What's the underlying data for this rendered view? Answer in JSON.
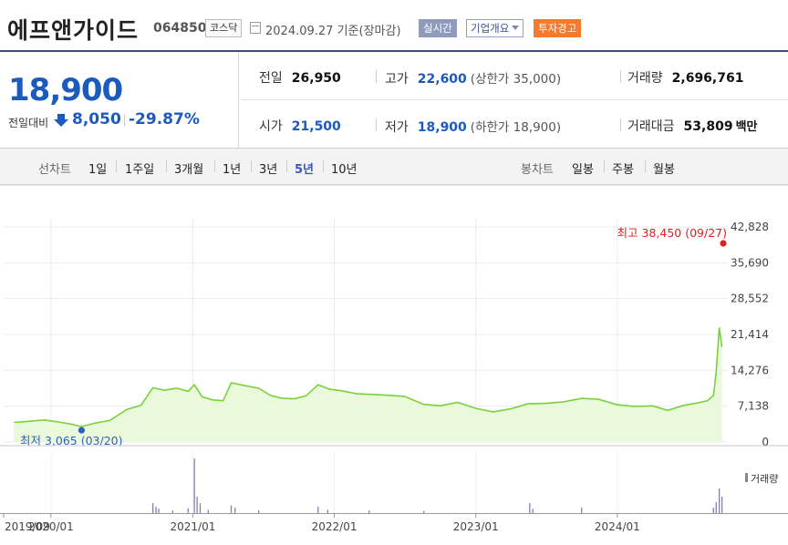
{
  "header": {
    "name": "에프앤가이드",
    "code": "064850",
    "market": "코스닥",
    "date": "2024.09.27",
    "date_note": "기준(장마감)",
    "btn_realtime": "실시간",
    "btn_company": "기업개요",
    "btn_warning": "투자경고"
  },
  "quote": {
    "price": "18,900",
    "change_label": "전일대비",
    "change_value": "8,050",
    "change_pct": "-29.87%",
    "down_color": "#1a5bbd",
    "prev_close_label": "전일",
    "prev_close": "26,950",
    "open_label": "시가",
    "open": "21,500",
    "high_label": "고가",
    "high": "22,600",
    "upper_limit": "(상한가 35,000)",
    "low_label": "저가",
    "low": "18,900",
    "lower_limit": "(하한가 18,900)",
    "volume_label": "거래량",
    "volume": "2,696,761",
    "amount_label": "거래대금",
    "amount": "53,809",
    "amount_unit": "백만"
  },
  "period_bar": {
    "line_title": "선차트",
    "periods": [
      "1일",
      "1주일",
      "3개월",
      "1년",
      "3년",
      "5년",
      "10년"
    ],
    "selected": "5년",
    "candle_title": "봉차트",
    "candles": [
      "일봉",
      "주봉",
      "월봉"
    ]
  },
  "chart_data": {
    "type": "area",
    "line_color": "#7ad23a",
    "fill_color": "#eaf8dc",
    "y_ticks": [
      "0",
      "7,138",
      "14,276",
      "21,414",
      "28,552",
      "35,690",
      "42,828"
    ],
    "ylim": [
      0,
      42828
    ],
    "x_ticks": [
      "2019/09",
      "2020/01",
      "2021/01",
      "2022/01",
      "2023/01",
      "2024/01"
    ],
    "max_label": "최고",
    "max_value": "38,450",
    "max_date": "(09/27)",
    "max_color": "#e0201e",
    "min_label": "최저",
    "min_value": "3,065",
    "min_date": "(03/20)",
    "min_color": "#2f63b8",
    "volume_legend": "거래량",
    "series": [
      {
        "x": "2019-09-27",
        "y": 3900
      },
      {
        "x": "2019-11-01",
        "y": 4100
      },
      {
        "x": "2019-12-15",
        "y": 4400
      },
      {
        "x": "2020-01-20",
        "y": 4000
      },
      {
        "x": "2020-02-20",
        "y": 3600
      },
      {
        "x": "2020-03-20",
        "y": 3065
      },
      {
        "x": "2020-04-20",
        "y": 3700
      },
      {
        "x": "2020-06-01",
        "y": 4300
      },
      {
        "x": "2020-07-15",
        "y": 6500
      },
      {
        "x": "2020-08-20",
        "y": 7300
      },
      {
        "x": "2020-09-20",
        "y": 10800
      },
      {
        "x": "2020-10-20",
        "y": 10300
      },
      {
        "x": "2020-11-20",
        "y": 10700
      },
      {
        "x": "2020-12-20",
        "y": 10100
      },
      {
        "x": "2021-01-05",
        "y": 11400
      },
      {
        "x": "2021-01-25",
        "y": 9000
      },
      {
        "x": "2021-02-20",
        "y": 8400
      },
      {
        "x": "2021-03-20",
        "y": 8200
      },
      {
        "x": "2021-04-10",
        "y": 11800
      },
      {
        "x": "2021-05-10",
        "y": 11300
      },
      {
        "x": "2021-06-20",
        "y": 10700
      },
      {
        "x": "2021-07-20",
        "y": 9300
      },
      {
        "x": "2021-08-20",
        "y": 8700
      },
      {
        "x": "2021-09-20",
        "y": 8600
      },
      {
        "x": "2021-10-20",
        "y": 9200
      },
      {
        "x": "2021-11-20",
        "y": 11400
      },
      {
        "x": "2021-12-20",
        "y": 10500
      },
      {
        "x": "2022-01-20",
        "y": 10200
      },
      {
        "x": "2022-03-01",
        "y": 9600
      },
      {
        "x": "2022-05-01",
        "y": 9400
      },
      {
        "x": "2022-07-01",
        "y": 9100
      },
      {
        "x": "2022-08-20",
        "y": 7500
      },
      {
        "x": "2022-10-01",
        "y": 7200
      },
      {
        "x": "2022-11-15",
        "y": 7900
      },
      {
        "x": "2023-01-01",
        "y": 6700
      },
      {
        "x": "2023-02-15",
        "y": 6000
      },
      {
        "x": "2023-04-01",
        "y": 6600
      },
      {
        "x": "2023-05-15",
        "y": 7600
      },
      {
        "x": "2023-07-01",
        "y": 7700
      },
      {
        "x": "2023-08-15",
        "y": 8000
      },
      {
        "x": "2023-10-01",
        "y": 8700
      },
      {
        "x": "2023-11-15",
        "y": 8500
      },
      {
        "x": "2024-01-01",
        "y": 7400
      },
      {
        "x": "2024-02-15",
        "y": 7100
      },
      {
        "x": "2024-04-01",
        "y": 7200
      },
      {
        "x": "2024-05-10",
        "y": 6300
      },
      {
        "x": "2024-06-20",
        "y": 7300
      },
      {
        "x": "2024-07-20",
        "y": 7700
      },
      {
        "x": "2024-08-20",
        "y": 8200
      },
      {
        "x": "2024-09-05",
        "y": 9300
      },
      {
        "x": "2024-09-12",
        "y": 13800
      },
      {
        "x": "2024-09-20",
        "y": 22800
      },
      {
        "x": "2024-09-27",
        "y": 18900
      }
    ],
    "volume": [
      {
        "x": "2020-09-20",
        "v": 0.18
      },
      {
        "x": "2020-09-28",
        "v": 0.12
      },
      {
        "x": "2020-10-05",
        "v": 0.08
      },
      {
        "x": "2020-11-10",
        "v": 0.05
      },
      {
        "x": "2020-12-20",
        "v": 0.09
      },
      {
        "x": "2021-01-05",
        "v": 1.0
      },
      {
        "x": "2021-01-12",
        "v": 0.3
      },
      {
        "x": "2021-01-20",
        "v": 0.18
      },
      {
        "x": "2021-02-10",
        "v": 0.06
      },
      {
        "x": "2021-04-10",
        "v": 0.14
      },
      {
        "x": "2021-04-20",
        "v": 0.1
      },
      {
        "x": "2021-06-20",
        "v": 0.05
      },
      {
        "x": "2021-11-20",
        "v": 0.12
      },
      {
        "x": "2021-12-15",
        "v": 0.06
      },
      {
        "x": "2022-04-01",
        "v": 0.05
      },
      {
        "x": "2022-08-20",
        "v": 0.04
      },
      {
        "x": "2023-05-20",
        "v": 0.18
      },
      {
        "x": "2023-05-28",
        "v": 0.08
      },
      {
        "x": "2023-10-01",
        "v": 0.1
      },
      {
        "x": "2024-09-05",
        "v": 0.1
      },
      {
        "x": "2024-09-12",
        "v": 0.2
      },
      {
        "x": "2024-09-20",
        "v": 0.45
      },
      {
        "x": "2024-09-27",
        "v": 0.3
      }
    ]
  }
}
